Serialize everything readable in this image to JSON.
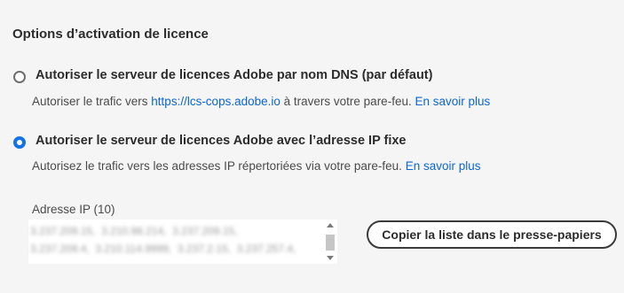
{
  "section": {
    "title": "Options d’activation de licence"
  },
  "options": [
    {
      "label": "Autoriser le serveur de licences Adobe par nom DNS (par défaut)",
      "selected": false,
      "desc_before": "Autoriser le trafic vers ",
      "desc_link": "https://lcs-cops.adobe.io",
      "desc_after": " à travers votre pare-feu. ",
      "learn_more": "En savoir plus"
    },
    {
      "label": "Autoriser le serveur de licences Adobe avec l’adresse IP fixe",
      "selected": true,
      "desc_before": "Autorisez le trafic vers les adresses IP répertoriées via votre pare-feu. ",
      "learn_more": "En savoir plus"
    }
  ],
  "ip_list": {
    "label": "Adresse IP (10)"
  },
  "copy_button": {
    "label": "Copier la liste dans le presse-papiers"
  },
  "colors": {
    "accent": "#1473e6",
    "link": "#0d66d0",
    "background": "#f5f5f5"
  }
}
